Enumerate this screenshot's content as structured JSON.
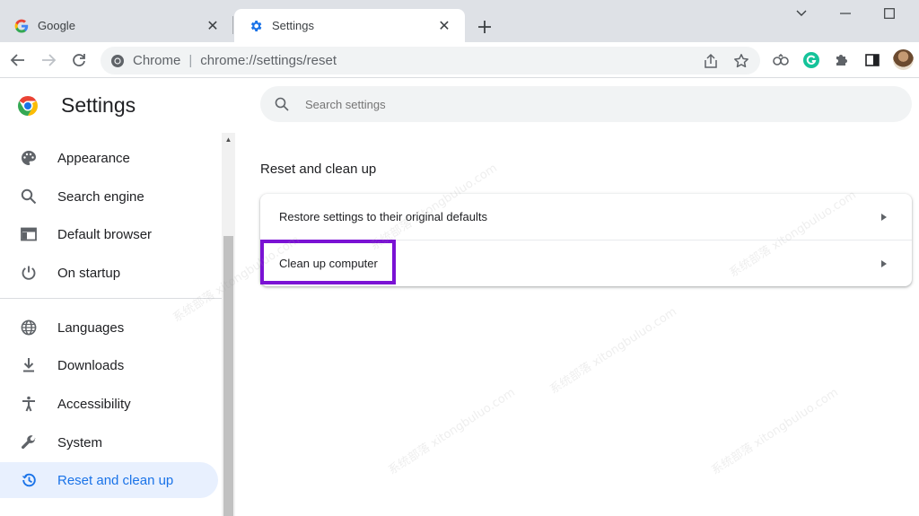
{
  "tabs": [
    {
      "title": "Google",
      "icon": "google-g-icon"
    },
    {
      "title": "Settings",
      "icon": "gear-icon"
    }
  ],
  "omnibox": {
    "site_name": "Chrome",
    "separator": "|",
    "url": "chrome://settings/reset"
  },
  "header": {
    "title": "Settings",
    "search_placeholder": "Search settings"
  },
  "sidebar": {
    "items": [
      {
        "label": "Appearance",
        "icon": "palette-icon"
      },
      {
        "label": "Search engine",
        "icon": "search-icon"
      },
      {
        "label": "Default browser",
        "icon": "browser-window-icon"
      },
      {
        "label": "On startup",
        "icon": "power-icon"
      },
      {
        "label": "Languages",
        "icon": "globe-icon"
      },
      {
        "label": "Downloads",
        "icon": "download-icon"
      },
      {
        "label": "Accessibility",
        "icon": "accessibility-icon"
      },
      {
        "label": "System",
        "icon": "wrench-icon"
      },
      {
        "label": "Reset and clean up",
        "icon": "restore-icon",
        "selected": true
      }
    ]
  },
  "main": {
    "section_title": "Reset and clean up",
    "rows": [
      {
        "label": "Restore settings to their original defaults"
      },
      {
        "label": "Clean up computer",
        "highlighted": true
      }
    ]
  },
  "watermark": "系统部落 xitongbuluo.com",
  "colors": {
    "accent": "#1a73e8",
    "selected_bg": "#e8f0fe",
    "highlight_border": "#7a12d4",
    "tabstrip_bg": "#dee1e6"
  }
}
